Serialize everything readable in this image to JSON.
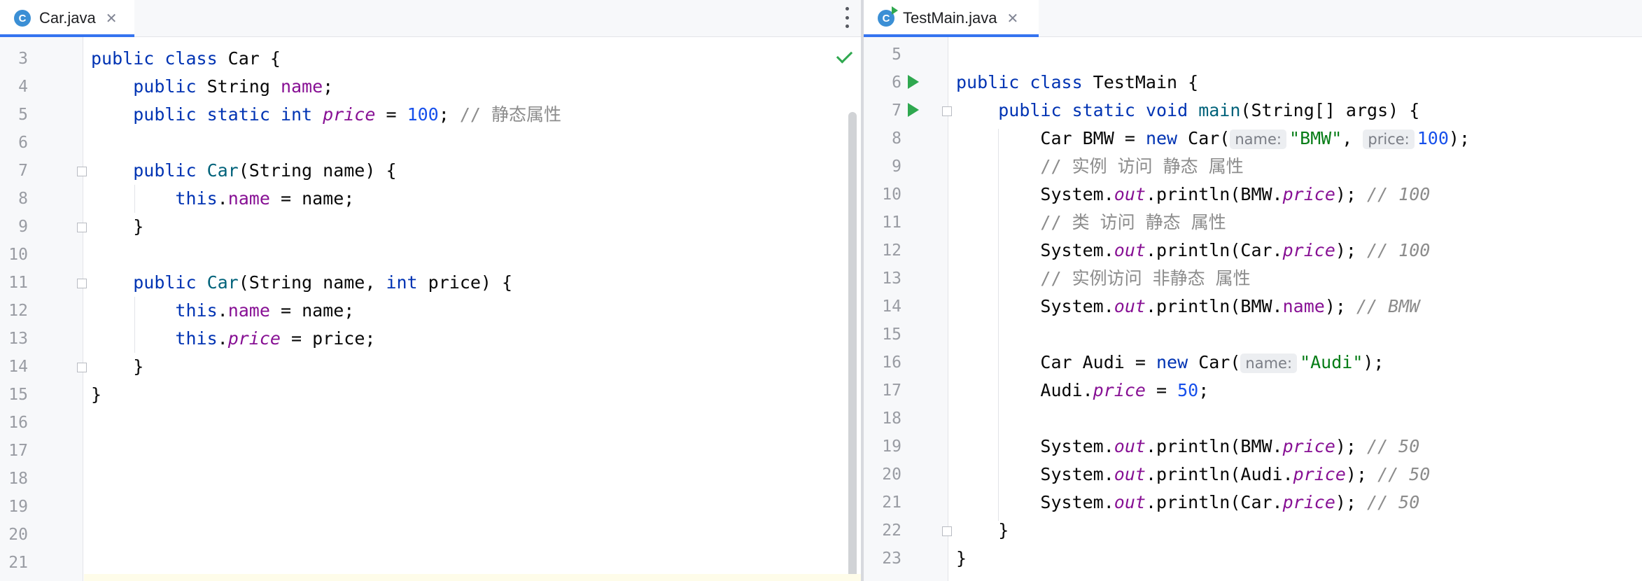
{
  "left_editor": {
    "tab": {
      "icon_letter": "C",
      "filename": "Car.java",
      "close": "✕"
    },
    "lines": [
      {
        "n": "3",
        "tokens": [
          [
            "kw",
            "public "
          ],
          [
            "kw",
            "class "
          ],
          [
            "",
            "Car {"
          ]
        ]
      },
      {
        "n": "4",
        "tokens": [
          [
            "",
            "    "
          ],
          [
            "kw",
            "public "
          ],
          [
            "",
            "String "
          ],
          [
            "fld",
            "name"
          ],
          [
            "",
            ";"
          ]
        ]
      },
      {
        "n": "5",
        "tokens": [
          [
            "",
            "    "
          ],
          [
            "kw",
            "public "
          ],
          [
            "kw",
            "static "
          ],
          [
            "kw",
            "int "
          ],
          [
            "sfld",
            "price"
          ],
          [
            "",
            " = "
          ],
          [
            "num",
            "100"
          ],
          [
            "",
            "; "
          ],
          [
            "cmt",
            "// 静态属性"
          ]
        ]
      },
      {
        "n": "6",
        "tokens": []
      },
      {
        "n": "7",
        "tokens": [
          [
            "",
            "    "
          ],
          [
            "kw",
            "public "
          ],
          [
            "ctor",
            "Car"
          ],
          [
            "",
            "(String name) {"
          ]
        ]
      },
      {
        "n": "8",
        "tokens": [
          [
            "",
            "        "
          ],
          [
            "kw",
            "this"
          ],
          [
            "",
            "."
          ],
          [
            "fld",
            "name"
          ],
          [
            "",
            " = name;"
          ]
        ]
      },
      {
        "n": "9",
        "tokens": [
          [
            "",
            "    }"
          ]
        ]
      },
      {
        "n": "10",
        "tokens": []
      },
      {
        "n": "11",
        "tokens": [
          [
            "",
            "    "
          ],
          [
            "kw",
            "public "
          ],
          [
            "ctor",
            "Car"
          ],
          [
            "",
            "(String name, "
          ],
          [
            "kw",
            "int "
          ],
          [
            "",
            "price) {"
          ]
        ]
      },
      {
        "n": "12",
        "tokens": [
          [
            "",
            "        "
          ],
          [
            "kw",
            "this"
          ],
          [
            "",
            "."
          ],
          [
            "fld",
            "name"
          ],
          [
            "",
            " = name;"
          ]
        ]
      },
      {
        "n": "13",
        "tokens": [
          [
            "",
            "        "
          ],
          [
            "kw",
            "this"
          ],
          [
            "",
            "."
          ],
          [
            "sfld",
            "price"
          ],
          [
            "",
            " = price;"
          ]
        ]
      },
      {
        "n": "14",
        "tokens": [
          [
            "",
            "    }"
          ]
        ]
      },
      {
        "n": "15",
        "tokens": [
          [
            "",
            "}"
          ]
        ]
      },
      {
        "n": "16",
        "tokens": []
      },
      {
        "n": "17",
        "tokens": []
      },
      {
        "n": "18",
        "tokens": []
      },
      {
        "n": "19",
        "tokens": []
      },
      {
        "n": "20",
        "tokens": []
      },
      {
        "n": "21",
        "tokens": []
      }
    ]
  },
  "right_editor": {
    "tab": {
      "icon_letter": "C",
      "filename": "TestMain.java",
      "close": "✕"
    },
    "lines": [
      {
        "n": "5",
        "tokens": []
      },
      {
        "n": "6",
        "tokens": [
          [
            "kw",
            "public "
          ],
          [
            "kw",
            "class "
          ],
          [
            "",
            "TestMain {"
          ]
        ]
      },
      {
        "n": "7",
        "tokens": [
          [
            "",
            "    "
          ],
          [
            "kw",
            "public "
          ],
          [
            "kw",
            "static "
          ],
          [
            "kw",
            "void "
          ],
          [
            "mth",
            "main"
          ],
          [
            "",
            "(String[] args) {"
          ]
        ]
      },
      {
        "n": "8",
        "tokens": [
          [
            "",
            "        Car BMW = "
          ],
          [
            "kw",
            "new "
          ],
          [
            "",
            "Car("
          ],
          [
            "hint",
            "name:"
          ],
          [
            "str",
            "\"BMW\""
          ],
          [
            "",
            ", "
          ],
          [
            "hint",
            "price:"
          ],
          [
            "num",
            "100"
          ],
          [
            "",
            ");"
          ]
        ]
      },
      {
        "n": "9",
        "tokens": [
          [
            "",
            "        "
          ],
          [
            "cmt",
            "// 实例 访问 静态 属性"
          ]
        ]
      },
      {
        "n": "10",
        "tokens": [
          [
            "",
            "        System."
          ],
          [
            "sfld",
            "out"
          ],
          [
            "",
            ".println(BMW."
          ],
          [
            "sfld",
            "price"
          ],
          [
            "",
            "); "
          ],
          [
            "icmt",
            "// 100"
          ]
        ]
      },
      {
        "n": "11",
        "tokens": [
          [
            "",
            "        "
          ],
          [
            "cmt",
            "// 类 访问 静态 属性"
          ]
        ]
      },
      {
        "n": "12",
        "tokens": [
          [
            "",
            "        System."
          ],
          [
            "sfld",
            "out"
          ],
          [
            "",
            ".println(Car."
          ],
          [
            "sfld",
            "price"
          ],
          [
            "",
            "); "
          ],
          [
            "icmt",
            "// 100"
          ]
        ]
      },
      {
        "n": "13",
        "tokens": [
          [
            "",
            "        "
          ],
          [
            "cmt",
            "// 实例访问 非静态 属性"
          ]
        ]
      },
      {
        "n": "14",
        "tokens": [
          [
            "",
            "        System."
          ],
          [
            "sfld",
            "out"
          ],
          [
            "",
            ".println(BMW."
          ],
          [
            "fld",
            "name"
          ],
          [
            "",
            "); "
          ],
          [
            "icmt",
            "// BMW"
          ]
        ]
      },
      {
        "n": "15",
        "tokens": []
      },
      {
        "n": "16",
        "tokens": [
          [
            "",
            "        Car Audi = "
          ],
          [
            "kw",
            "new "
          ],
          [
            "",
            "Car("
          ],
          [
            "hint",
            "name:"
          ],
          [
            "str",
            "\"Audi\""
          ],
          [
            "",
            ");"
          ]
        ]
      },
      {
        "n": "17",
        "tokens": [
          [
            "",
            "        Audi."
          ],
          [
            "sfld",
            "price"
          ],
          [
            "",
            " = "
          ],
          [
            "num",
            "50"
          ],
          [
            "",
            ";"
          ]
        ]
      },
      {
        "n": "18",
        "tokens": []
      },
      {
        "n": "19",
        "tokens": [
          [
            "",
            "        System."
          ],
          [
            "sfld",
            "out"
          ],
          [
            "",
            ".println(BMW."
          ],
          [
            "sfld",
            "price"
          ],
          [
            "",
            "); "
          ],
          [
            "icmt",
            "// 50"
          ]
        ]
      },
      {
        "n": "20",
        "tokens": [
          [
            "",
            "        System."
          ],
          [
            "sfld",
            "out"
          ],
          [
            "",
            ".println(Audi."
          ],
          [
            "sfld",
            "price"
          ],
          [
            "",
            "); "
          ],
          [
            "icmt",
            "// 50"
          ]
        ]
      },
      {
        "n": "21",
        "tokens": [
          [
            "",
            "        System."
          ],
          [
            "sfld",
            "out"
          ],
          [
            "",
            ".println(Car."
          ],
          [
            "sfld",
            "price"
          ],
          [
            "",
            "); "
          ],
          [
            "icmt",
            "// 50"
          ]
        ]
      },
      {
        "n": "22",
        "tokens": [
          [
            "",
            "    }"
          ]
        ]
      },
      {
        "n": "23",
        "tokens": [
          [
            "",
            "}"
          ]
        ]
      }
    ]
  },
  "colors": {
    "keyword": "#0033b3",
    "field": "#871094",
    "number": "#1750eb",
    "string": "#067d17",
    "comment": "#8c8c8c",
    "active_tab_underline": "#3574f0",
    "run_icon": "#2fa84f"
  },
  "icons": [
    "class-file-icon",
    "close-icon",
    "more-vertical-icon",
    "run-gutter-icon",
    "fold-marker-icon",
    "inspection-ok-icon"
  ]
}
